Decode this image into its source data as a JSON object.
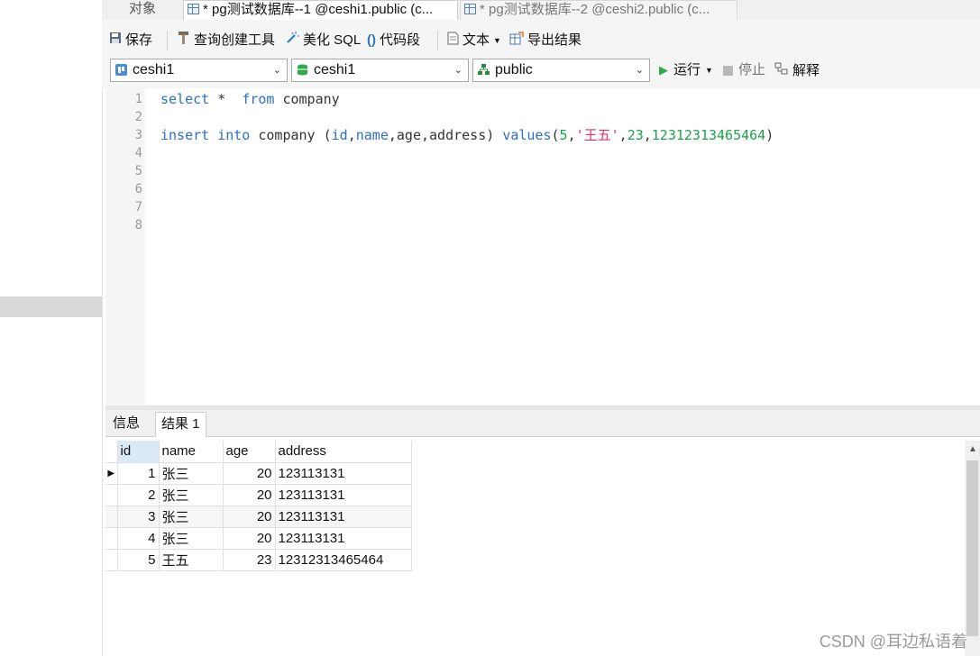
{
  "tabs": {
    "objects": "对象",
    "query1": "* pg测试数据库--1 @ceshi1.public (c...",
    "query2": "* pg测试数据库--2 @ceshi2.public (c..."
  },
  "toolbar": {
    "save": "保存",
    "query_builder": "查询创建工具",
    "beautify": "美化 SQL",
    "snippet": "代码段",
    "text": "文本",
    "export": "导出结果"
  },
  "selectors": {
    "connection": "ceshi1",
    "database": "ceshi1",
    "schema": "public"
  },
  "run_controls": {
    "run": "运行",
    "stop": "停止",
    "explain": "解释"
  },
  "editor": {
    "line_numbers": [
      "1",
      "2",
      "3",
      "4",
      "5",
      "6",
      "7",
      "8"
    ],
    "line1": {
      "kw1": "select",
      "mid": " *  ",
      "kw2": "from",
      "rest": " company"
    },
    "line3": {
      "kw1": "insert",
      "kw2": "into",
      "t1": " company (",
      "c_id": "id",
      "c_name": "name",
      "c_rest": ",age,address) ",
      "kw3": "values",
      "v_open": "(",
      "v1": "5",
      "v2": "'王五'",
      "v3": "23",
      "v4": "12312313465464",
      "v_close": ")"
    }
  },
  "results": {
    "tab_info": "信息",
    "tab_result": "结果 1",
    "columns": [
      "id",
      "name",
      "age",
      "address"
    ],
    "rows": [
      [
        "1",
        "张三",
        "20",
        "123113131"
      ],
      [
        "2",
        "张三",
        "20",
        "123113131"
      ],
      [
        "3",
        "张三",
        "20",
        "123113131"
      ],
      [
        "4",
        "张三",
        "20",
        "123113131"
      ],
      [
        "5",
        "王五",
        "23",
        "12312313465464"
      ]
    ]
  },
  "watermark": "CSDN @耳边私语着"
}
